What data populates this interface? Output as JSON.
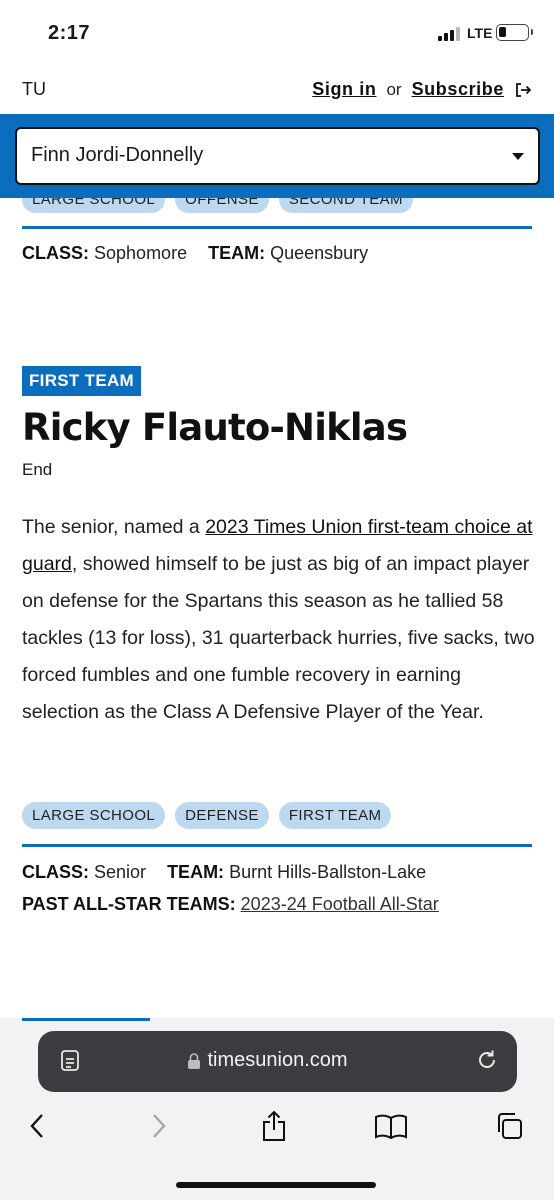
{
  "status_bar": {
    "time": "2:17",
    "network": "LTE"
  },
  "header": {
    "logo": "TU",
    "sign_in": "Sign in",
    "or": "or",
    "subscribe": "Subscribe"
  },
  "player_select": {
    "value": "Finn Jordi-Donnelly"
  },
  "previous_entry": {
    "tags": [
      "LARGE SCHOOL",
      "OFFENSE",
      "SECOND TEAM"
    ],
    "class_label": "CLASS:",
    "class_value": "Sophomore",
    "team_label": "TEAM:",
    "team_value": "Queensbury"
  },
  "entry": {
    "badge": "FIRST TEAM",
    "name": "Ricky Flauto-Niklas",
    "position": "End",
    "body_pre": "The senior, named a ",
    "body_link": "2023 Times Union first-team choice at guard",
    "body_post": ", showed himself to be just as big of an impact player on defense for the Spartans this season as he tallied 58 tackles (13 for loss), 31 quarterback hurries, five sacks, two forced fumbles and one fumble recovery in earning selection as the Class A Defensive Player of the Year.",
    "tags": [
      "LARGE SCHOOL",
      "DEFENSE",
      "FIRST TEAM"
    ],
    "class_label": "CLASS:",
    "class_value": "Senior",
    "team_label": "TEAM:",
    "team_value": "Burnt Hills-Ballston-Lake",
    "past_label": "PAST ALL-STAR TEAMS:",
    "past_link": "2023-24 Football All-Star"
  },
  "browser": {
    "url": "timesunion.com"
  },
  "colors": {
    "accent": "#0a6dbd",
    "tag_bg": "#bdd8ef",
    "urlbar_bg": "#3b3c3f"
  },
  "icons": [
    "signal-icon",
    "battery-icon",
    "exit-icon",
    "chevron-down-icon",
    "reader-icon",
    "lock-icon",
    "reload-icon",
    "back-icon",
    "forward-icon",
    "share-icon",
    "bookmarks-icon",
    "tabs-icon"
  ]
}
